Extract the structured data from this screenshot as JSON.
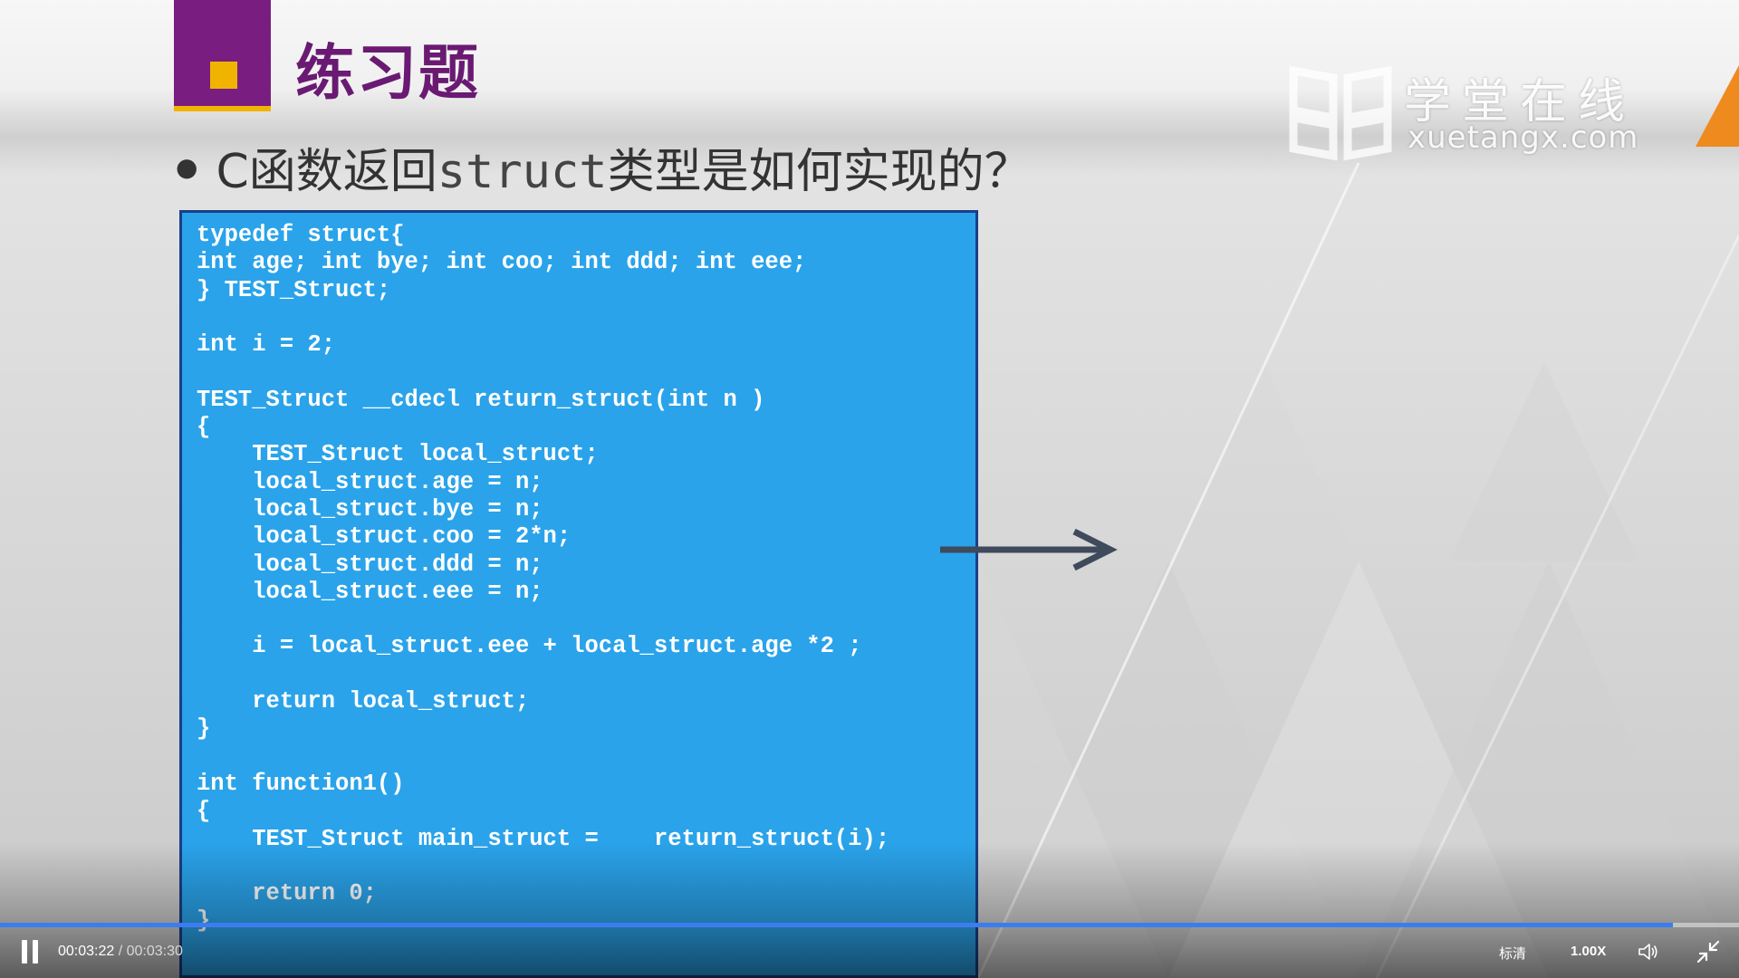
{
  "slide": {
    "title": "练习题",
    "bullet_prefix": "C函数返回",
    "bullet_code": "struct",
    "bullet_suffix": "类型是如何实现的？",
    "code": "typedef struct{\nint age; int bye; int coo; int ddd; int eee;\n} TEST_Struct;\n\nint i = 2;\n\nTEST_Struct __cdecl return_struct(int n )\n{\n    TEST_Struct local_struct;\n    local_struct.age = n;\n    local_struct.bye = n;\n    local_struct.coo = 2*n;\n    local_struct.ddd = n;\n    local_struct.eee = n;\n\n    i = local_struct.eee + local_struct.age *2 ;\n\n    return local_struct;\n}\n\nint function1()\n{\n    TEST_Struct main_struct =    return_struct(i);\n\n    return 0;\n}"
  },
  "watermark": {
    "cn": "学堂在线",
    "en": "xuetangx.com"
  },
  "player": {
    "current_time": "00:03:22",
    "separator": " / ",
    "duration": "00:03:30",
    "progress_fraction": 0.962,
    "quality": "标清",
    "speed": "1.00X",
    "play_icon": "pause-icon",
    "volume_icon": "volume-icon",
    "fullscreen_icon": "exit-fullscreen-icon"
  },
  "colors": {
    "title": "#6a1a72",
    "accent_purple": "#7a1d80",
    "accent_yellow": "#f0b400",
    "code_bg": "#2aa3ea",
    "progress": "#3b7df0"
  }
}
